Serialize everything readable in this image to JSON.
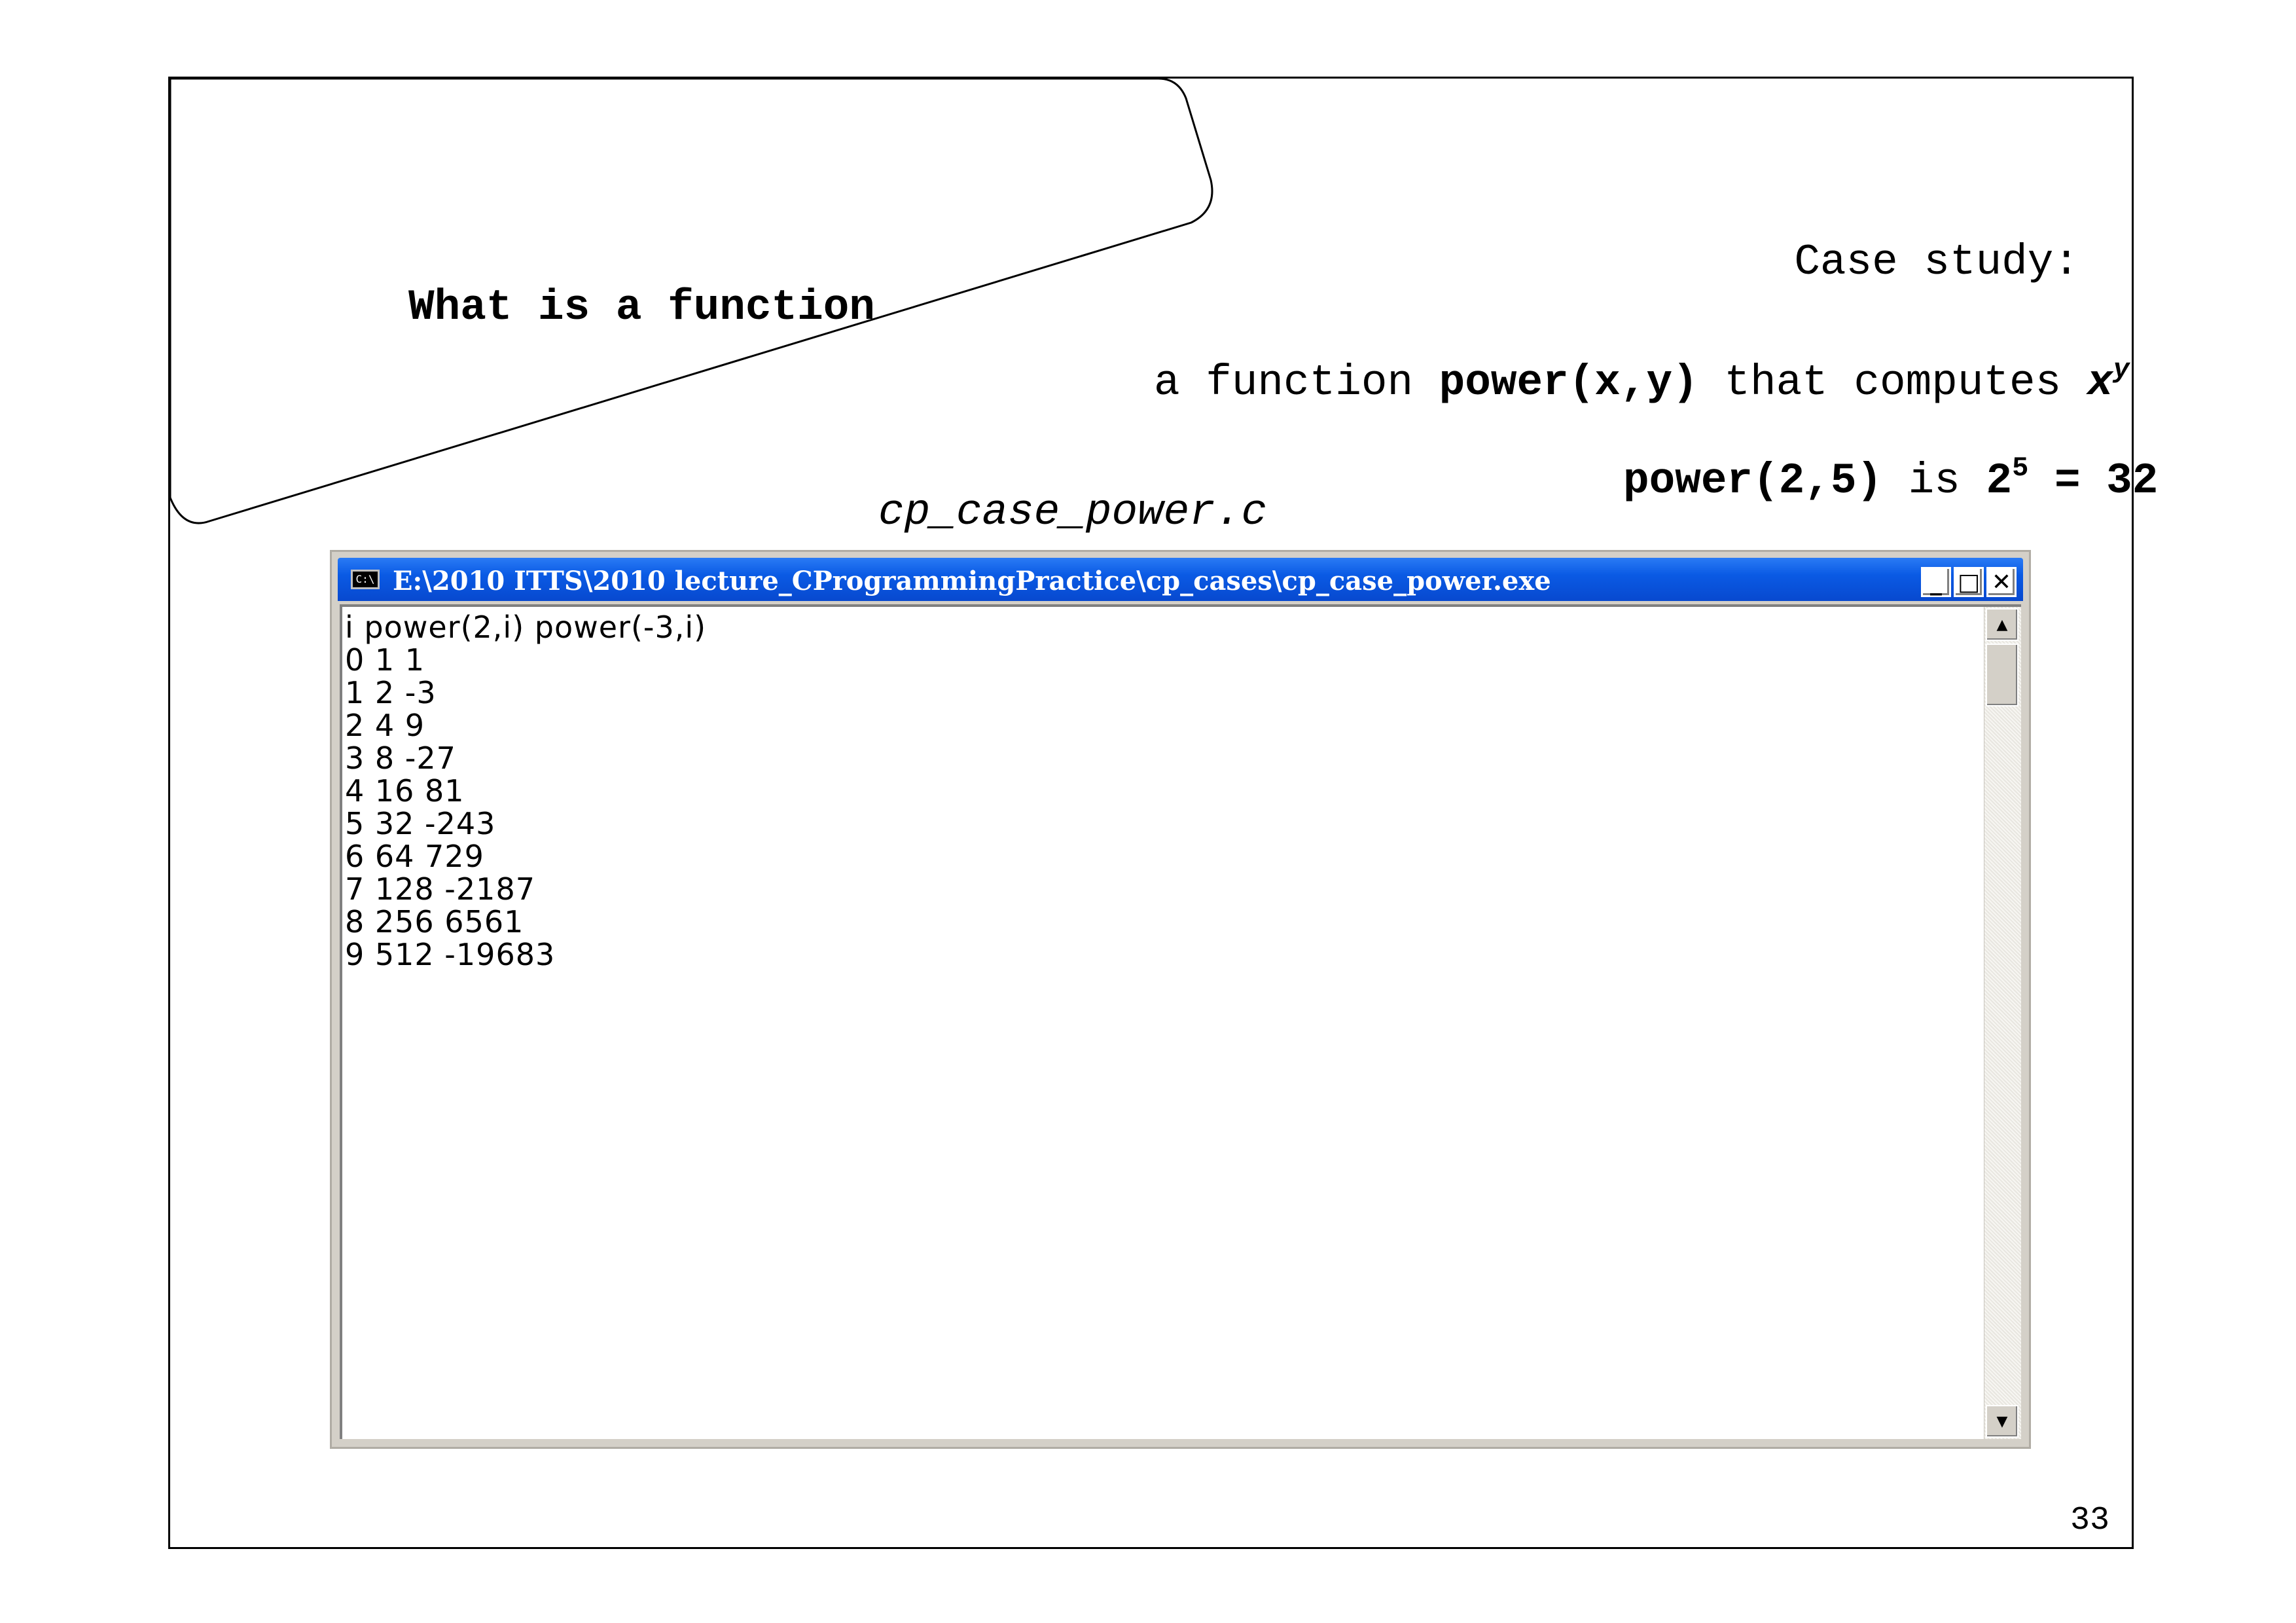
{
  "slide": {
    "title": "What is a function",
    "case_study": "Case study:",
    "desc_pre": "a function ",
    "desc_func": "power(x,y)",
    "desc_mid": " that computes ",
    "desc_base": "x",
    "desc_exp": "y",
    "example_call": "power(2,5)",
    "example_is": " is ",
    "example_base": "2",
    "example_exp": "5",
    "example_result": " = 32",
    "filename": "cp_case_power.c",
    "page_number": "33"
  },
  "window": {
    "icon_label": "C:\\",
    "title": "E:\\2010 ITTS\\2010 lecture_CProgrammingPractice\\cp_cases\\cp_case_power.exe",
    "minimize_label": "_",
    "maximize_label": "□",
    "close_label": "✕",
    "scroll_up_label": "▲",
    "scroll_down_label": "▼"
  },
  "console": {
    "header": "i power(2,i) power(-3,i)",
    "rows": [
      "0 1 1",
      "1 2 -3",
      "2 4 9",
      "3 8 -27",
      "4 16 81",
      "5 32 -243",
      "6 64 729",
      "7 128 -2187",
      "8 256 6561",
      "9 512 -19683"
    ]
  }
}
